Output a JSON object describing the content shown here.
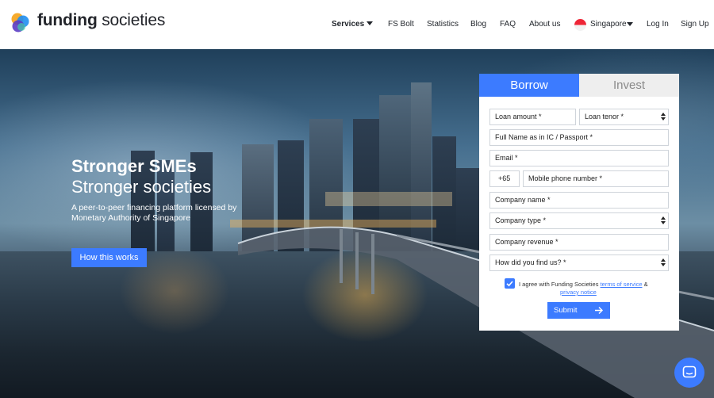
{
  "brand": {
    "name_bold": "funding",
    "name_rest": " societies"
  },
  "nav": {
    "services": "Services",
    "fs_bolt": "FS Bolt",
    "statistics": "Statistics",
    "blog": "Blog",
    "faq": "FAQ",
    "about": "About us",
    "country": "Singapore",
    "login": "Log In",
    "signup": "Sign Up"
  },
  "hero": {
    "title": "Stronger SMEs",
    "subtitle": "Stronger societies",
    "description": "A peer-to-peer financing platform licensed by Monetary Authority of Singapore",
    "cta": "How this works"
  },
  "form": {
    "tabs": [
      "Borrow",
      "Invest"
    ],
    "active_tab": "Borrow",
    "loan_amount": "Loan amount *",
    "loan_tenor": "Loan tenor *",
    "full_name": "Full Name as in IC / Passport *",
    "email": "Email *",
    "phone_code": "+65",
    "mobile": "Mobile phone number *",
    "company_name": "Company name *",
    "company_type": "Company type *",
    "company_revenue": "Company revenue *",
    "how_found": "How did you find us? *",
    "consent_text": "I agree with Funding Societies ",
    "terms": "terms of service",
    "amp": " &",
    "privacy": "privacy notice",
    "consent_checked": true,
    "submit": "Submit"
  },
  "colors": {
    "accent": "#3c7bff",
    "tab_inactive": "#eeeeee",
    "text": "#1f2329"
  },
  "icons": {
    "logo": "funding-societies-logo-icon",
    "services_caret": "caret-down-icon",
    "country_flag": "singapore-flag-icon",
    "submit_arrow": "arrow-right-icon",
    "chat": "chat-bubble-icon"
  }
}
